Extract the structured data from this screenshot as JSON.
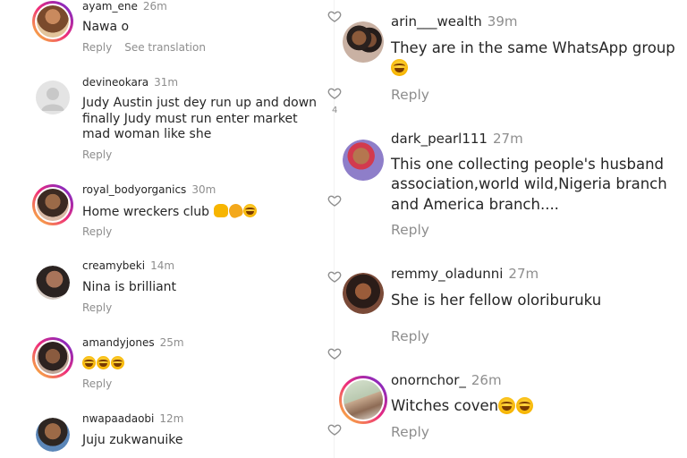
{
  "ui": {
    "reply_label": "Reply",
    "translate_label": "See translation"
  },
  "left_comments": [
    {
      "username": "ayam_ene",
      "time": "26m",
      "text": "Nawa o",
      "has_translation": true
    },
    {
      "username": "devineokara",
      "time": "31m",
      "text": "Judy Austin just dey run up and down finally Judy must run enter market mad woman like she"
    },
    {
      "username": "royal_bodyorganics",
      "time": "30m",
      "text": "Home wreckers club"
    },
    {
      "username": "creamybeki",
      "time": "14m",
      "text": "Nina is brilliant"
    },
    {
      "username": "amandyjones",
      "time": "25m",
      "text": ""
    },
    {
      "username": "nwapaadaobi",
      "time": "12m",
      "text": "Juju zukwanuike"
    }
  ],
  "right_comments": [
    {
      "username": "arin___wealth",
      "time": "39m",
      "text": "They are in the same WhatsApp group",
      "likes": "4"
    },
    {
      "username": "dark_pearl111",
      "time": "27m",
      "text": "This one collecting people's husband association,world wild,Nigeria branch and America branch...."
    },
    {
      "username": "remmy_oladunni",
      "time": "27m",
      "text": "She is her fellow oloriburuku"
    },
    {
      "username": "onornchor_",
      "time": "26m",
      "text": "Witches coven"
    }
  ]
}
